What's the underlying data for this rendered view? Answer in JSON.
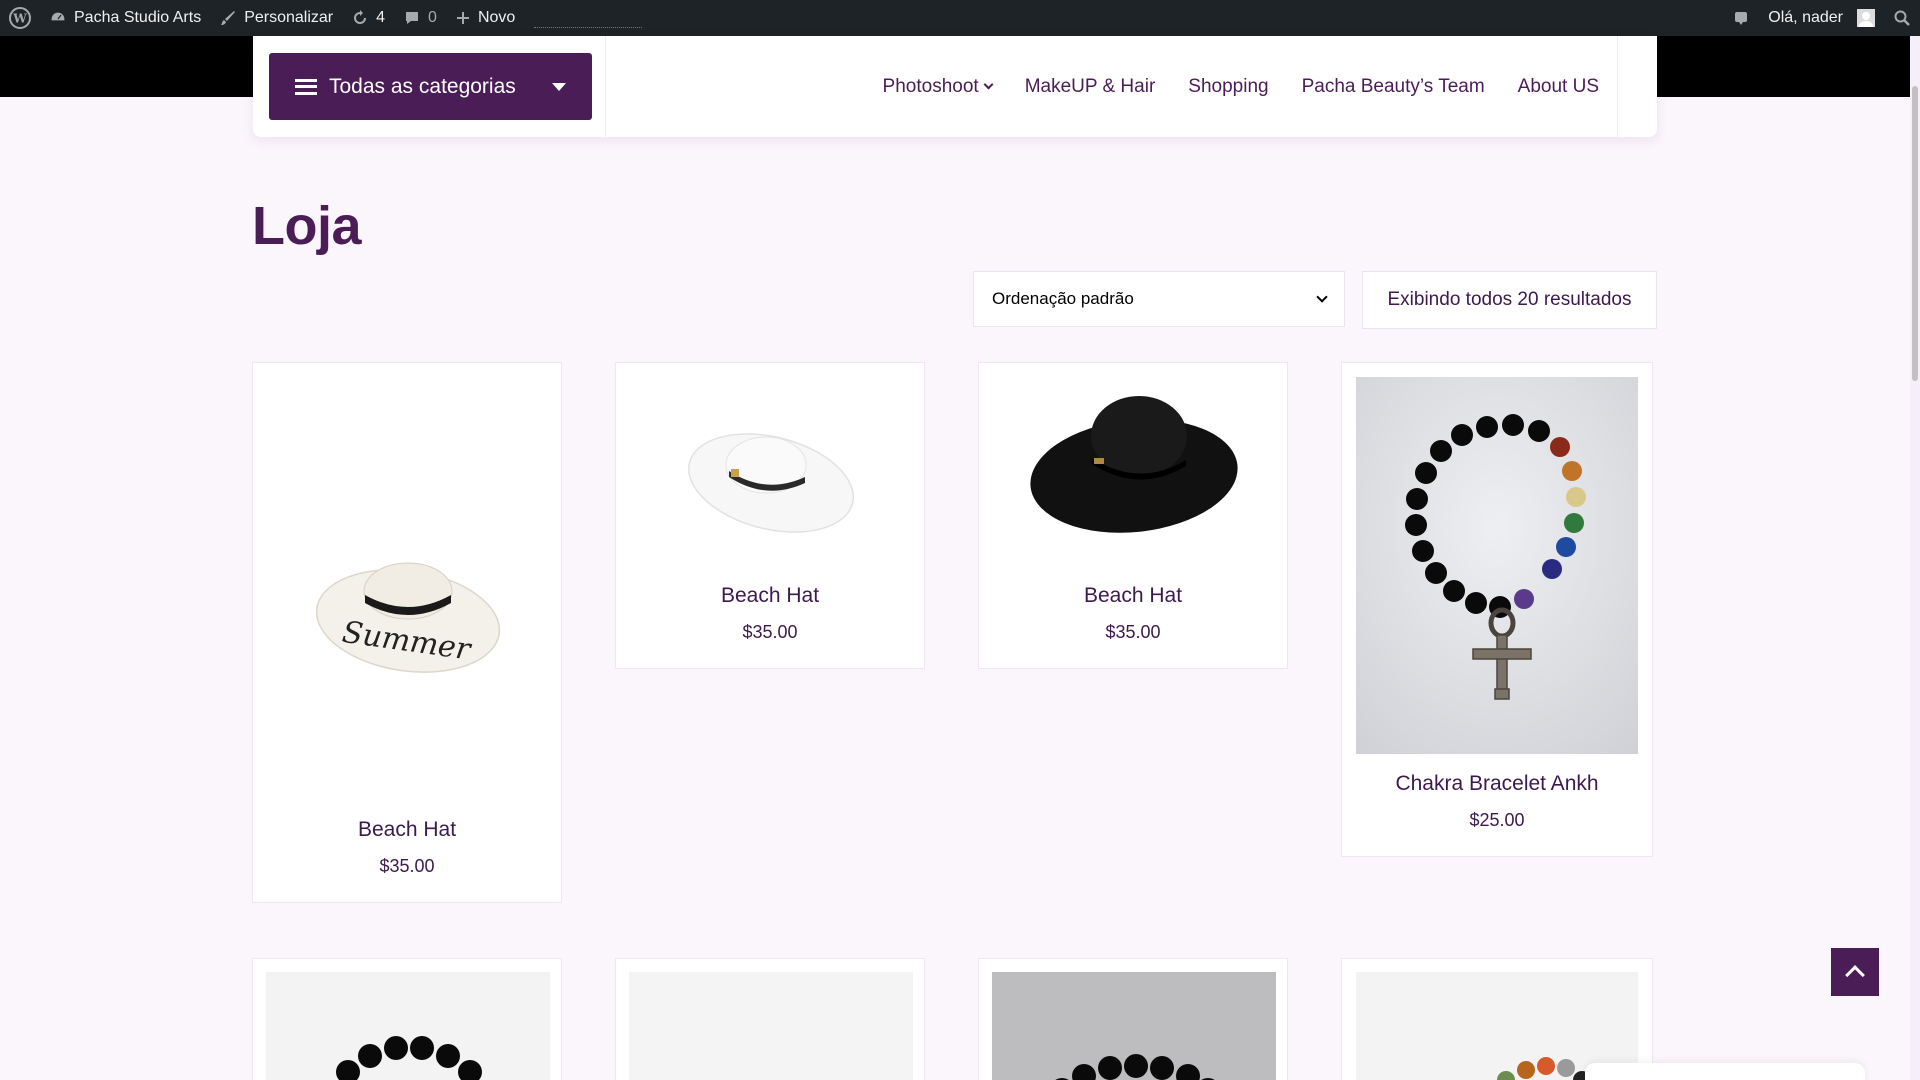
{
  "admin_bar": {
    "site_name": "Pacha Studio Arts",
    "customize": "Personalizar",
    "updates_count": "4",
    "comments_count": "0",
    "new_label": "Novo",
    "greeting": "Olá, nader"
  },
  "header": {
    "categories_button": "Todas as categorias",
    "nav": [
      {
        "label": "Photoshoot"
      },
      {
        "label": "MakeUP & Hair"
      },
      {
        "label": "Shopping"
      },
      {
        "label": "Pacha Beauty’s Team"
      },
      {
        "label": "About US"
      }
    ]
  },
  "page": {
    "title": "Loja",
    "orderby_selected": "Ordenação padrão",
    "result_count": "Exibindo todos 20 resultados"
  },
  "products": [
    {
      "title": "Beach Hat",
      "price": "$35.00",
      "image": "summer-hat"
    },
    {
      "title": "Beach Hat",
      "price": "$35.00",
      "image": "white-hat"
    },
    {
      "title": "Beach Hat",
      "price": "$35.00",
      "image": "black-hat"
    },
    {
      "title": "Chakra Bracelet Ankh",
      "price": "$25.00",
      "image": "ankh-bracelet"
    }
  ],
  "colors": {
    "brand_purple": "#4b1d57",
    "page_bg": "#fbf5fc",
    "admin_bar": "#1d2327"
  }
}
